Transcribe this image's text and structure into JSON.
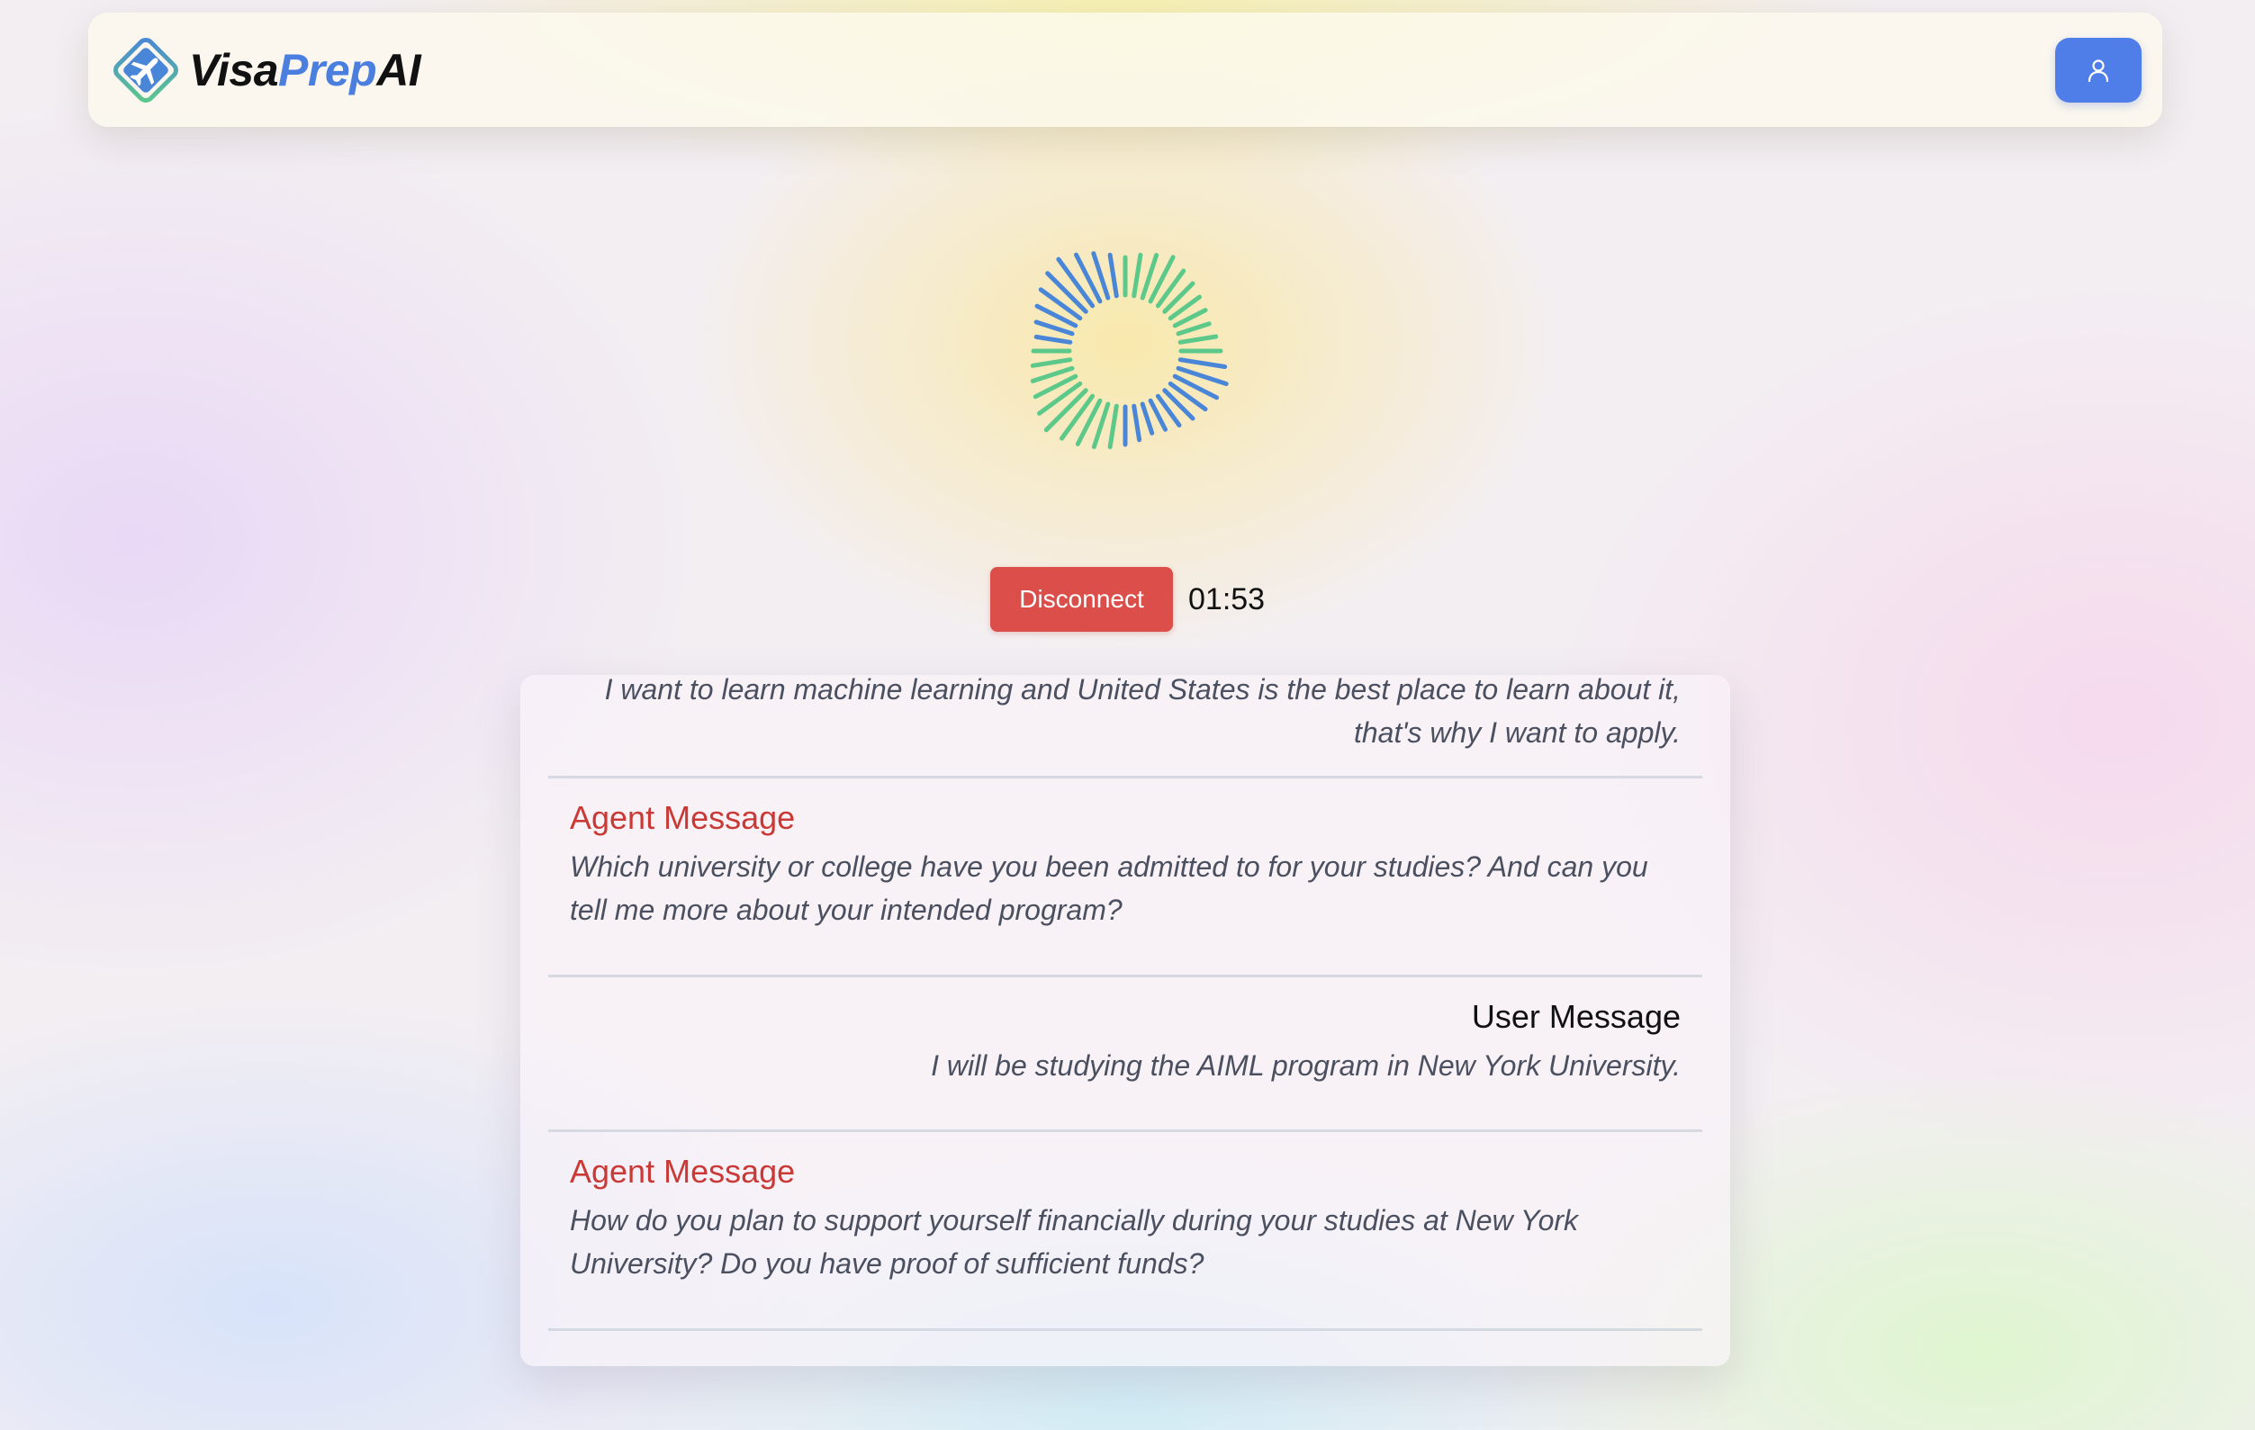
{
  "header": {
    "brand_part1": "Visa",
    "brand_part2": "Prep",
    "brand_part3": "AI",
    "logo_icon": "airplane-diamond-icon",
    "profile_icon": "user-icon"
  },
  "session": {
    "disconnect_label": "Disconnect",
    "timer": "01:53"
  },
  "transcript": {
    "messages": [
      {
        "role": "user",
        "label": "",
        "text": "I want to learn machine learning and United States is the best place to learn about it, that's why I want to apply."
      },
      {
        "role": "agent",
        "label": "Agent Message",
        "text": "Which university or college have you been admitted to for your studies? And can you tell me more about your intended program?"
      },
      {
        "role": "user",
        "label": "User Message",
        "text": "I will be studying the AIML program in New York University."
      },
      {
        "role": "agent",
        "label": "Agent Message",
        "text": "How do you plan to support yourself financially during your studies at New York University? Do you have proof of sufficient funds?"
      }
    ]
  },
  "colors": {
    "accent_blue": "#4f7ee8",
    "disconnect_red": "#dc4e4a",
    "agent_label_red": "#c93a36",
    "visualizer_blue": "#4a86d8",
    "visualizer_green": "#5cc98a"
  }
}
